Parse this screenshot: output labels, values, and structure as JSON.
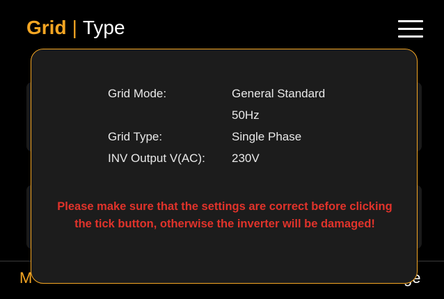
{
  "header": {
    "title_accent": "Grid",
    "separator": "|",
    "title_sub": "Type",
    "menu_icon": "hamburger-menu-icon"
  },
  "tabs": [
    {
      "label": "M"
    },
    {
      "label": "ge"
    }
  ],
  "dialog": {
    "rows": [
      {
        "label": "Grid Mode:",
        "value": "General Standard"
      },
      {
        "label": "",
        "value": "50Hz"
      },
      {
        "label": "Grid Type:",
        "value": "Single Phase"
      },
      {
        "label": "INV Output V(AC):",
        "value": "230V"
      }
    ],
    "warning": "Please make sure that the settings are correct before clicking the tick button, otherwise the inverter will be damaged!"
  },
  "colors": {
    "accent": "#f5a623",
    "warning": "#e0332b",
    "dialog_bg": "#1c1c1c"
  }
}
